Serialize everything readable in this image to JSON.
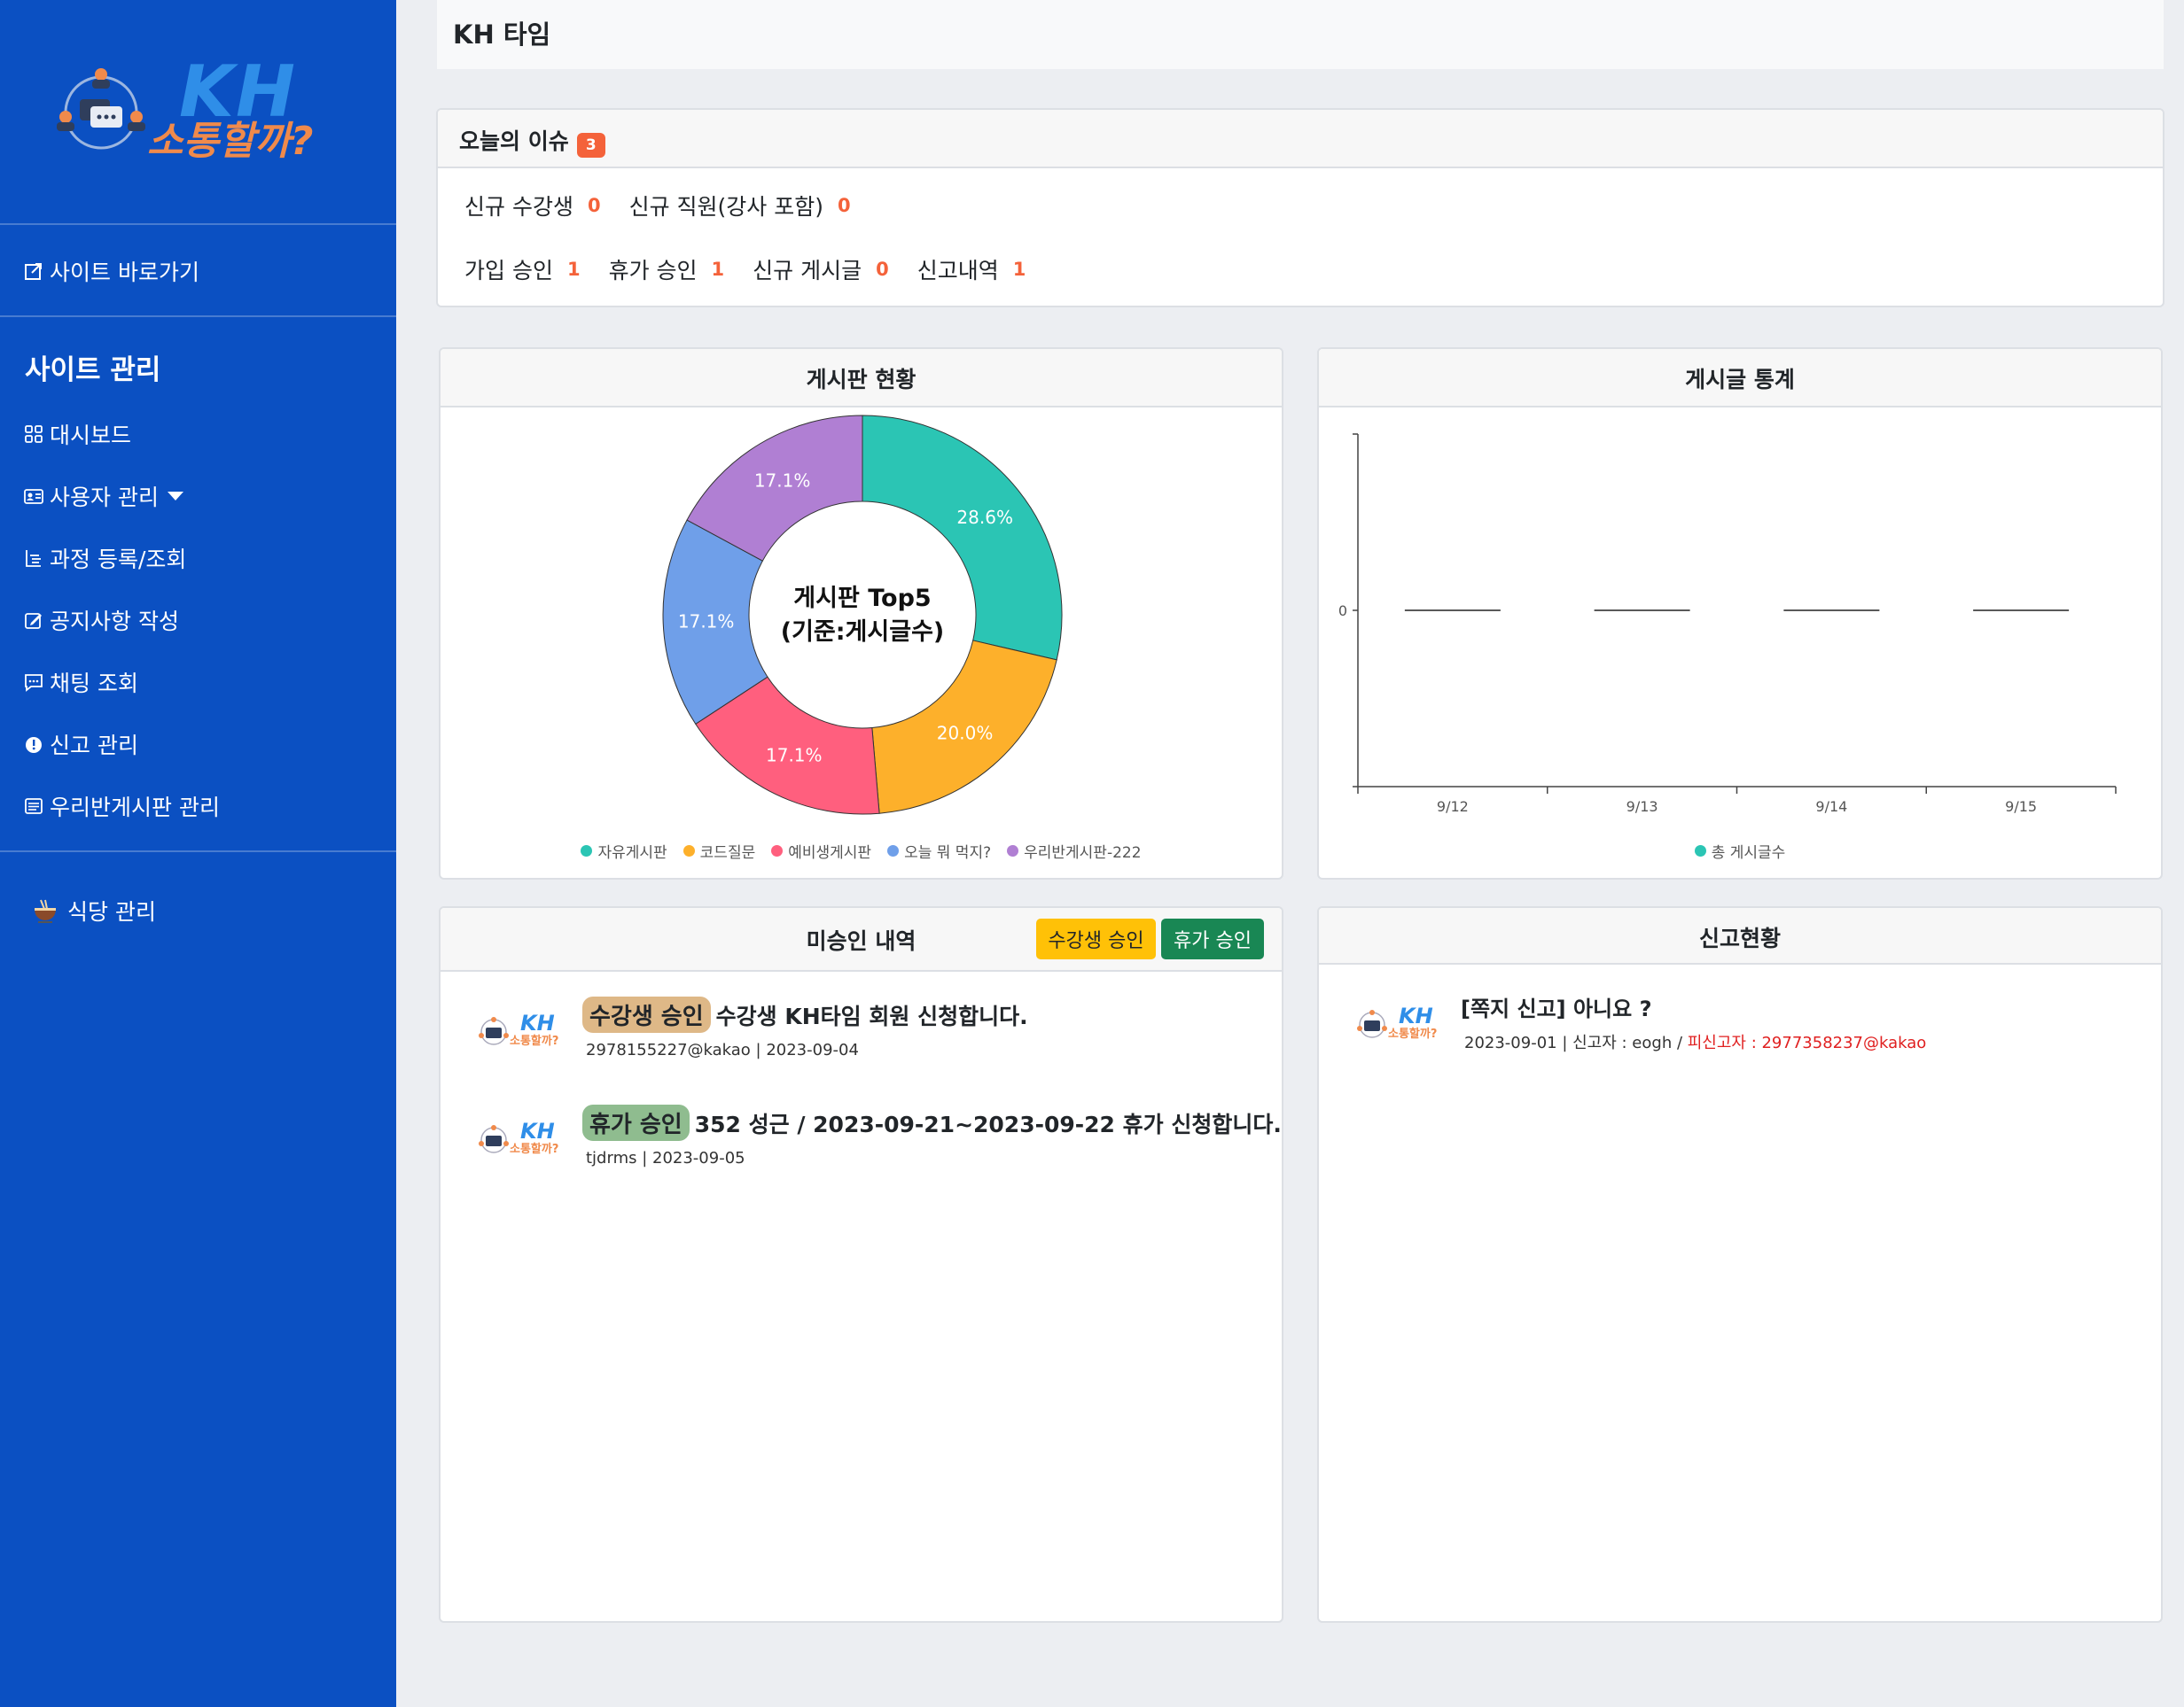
{
  "brand": {
    "logo_text": "KH",
    "logo_sub": "소통할까?"
  },
  "sidebar": {
    "site_link": "사이트 바로가기",
    "section_title": "사이트 관리",
    "items": [
      {
        "label": "대시보드",
        "icon": "grid-icon"
      },
      {
        "label": "사용자 관리",
        "icon": "user-card-icon"
      },
      {
        "label": "과정 등록/조회",
        "icon": "list-tree-icon"
      },
      {
        "label": "공지사항 작성",
        "icon": "edit-icon"
      },
      {
        "label": "채팅 조회",
        "icon": "chat-icon"
      },
      {
        "label": "신고 관리",
        "icon": "alert-icon"
      },
      {
        "label": "우리반게시판 관리",
        "icon": "board-icon"
      }
    ],
    "restaurant": "식당 관리"
  },
  "topbar": {
    "title": "KH 타임"
  },
  "issues": {
    "title": "오늘의 이슈",
    "badge": "3",
    "row1": [
      {
        "label": "신규 수강생",
        "value": "0"
      },
      {
        "label": "신규 직원(강사 포함)",
        "value": "0"
      }
    ],
    "row2": [
      {
        "label": "가입 승인",
        "value": "1"
      },
      {
        "label": "휴가 승인",
        "value": "1"
      },
      {
        "label": "신규 게시글",
        "value": "0"
      },
      {
        "label": "신고내역",
        "value": "1"
      }
    ]
  },
  "board_status": {
    "title": "게시판 현황",
    "center_line1": "게시판 Top5",
    "center_line2": "(기준:게시글수)"
  },
  "post_stats": {
    "title": "게시글 통계"
  },
  "pending": {
    "title": "미승인 내역",
    "btn_student": "수강생 승인",
    "btn_leave": "휴가 승인",
    "items": [
      {
        "tag": "수강생 승인",
        "text": "수강생 KH타임 회원 신청합니다.",
        "meta": "2978155227@kakao | 2023-09-04"
      },
      {
        "tag": "휴가 승인",
        "text": "352 성근 / 2023-09-21~2023-09-22 휴가 신청합니다.",
        "meta": "tjdrms | 2023-09-05"
      }
    ]
  },
  "reports": {
    "title": "신고현황",
    "items": [
      {
        "text": "[쪽지 신고] 아니요 ?",
        "meta": "2023-09-01 | 신고자 : eogh / ",
        "target": "피신고자 : 2977358237@kakao"
      }
    ]
  },
  "colors": {
    "sidebar": "#0b50c2",
    "accent": "#f4623a"
  },
  "chart_data": [
    {
      "type": "pie",
      "title": "게시판 Top5 (기준:게시글수)",
      "categories": [
        "자유게시판",
        "코드질문",
        "예비생게시판",
        "오늘 뭐 먹지?",
        "우리반게시판-222"
      ],
      "values": [
        28.6,
        20.0,
        17.1,
        17.1,
        17.1
      ],
      "value_labels": [
        "28.6%",
        "20.0%",
        "17.1%",
        "17.1%",
        "17.1%"
      ],
      "colors": [
        "#2bc5b4",
        "#fdb02b",
        "#ff5f7e",
        "#6f9fe9",
        "#b07fd3"
      ],
      "legend": "bottom"
    },
    {
      "type": "bar",
      "title": "",
      "categories": [
        "9/12",
        "9/13",
        "9/14",
        "9/15"
      ],
      "series": [
        {
          "name": "총 게시글수",
          "values": [
            0,
            0,
            0,
            0
          ],
          "color": "#2bc5b4"
        }
      ],
      "yticks": [
        "0"
      ],
      "ylim": [
        -1,
        1
      ],
      "legend": "bottom"
    }
  ]
}
